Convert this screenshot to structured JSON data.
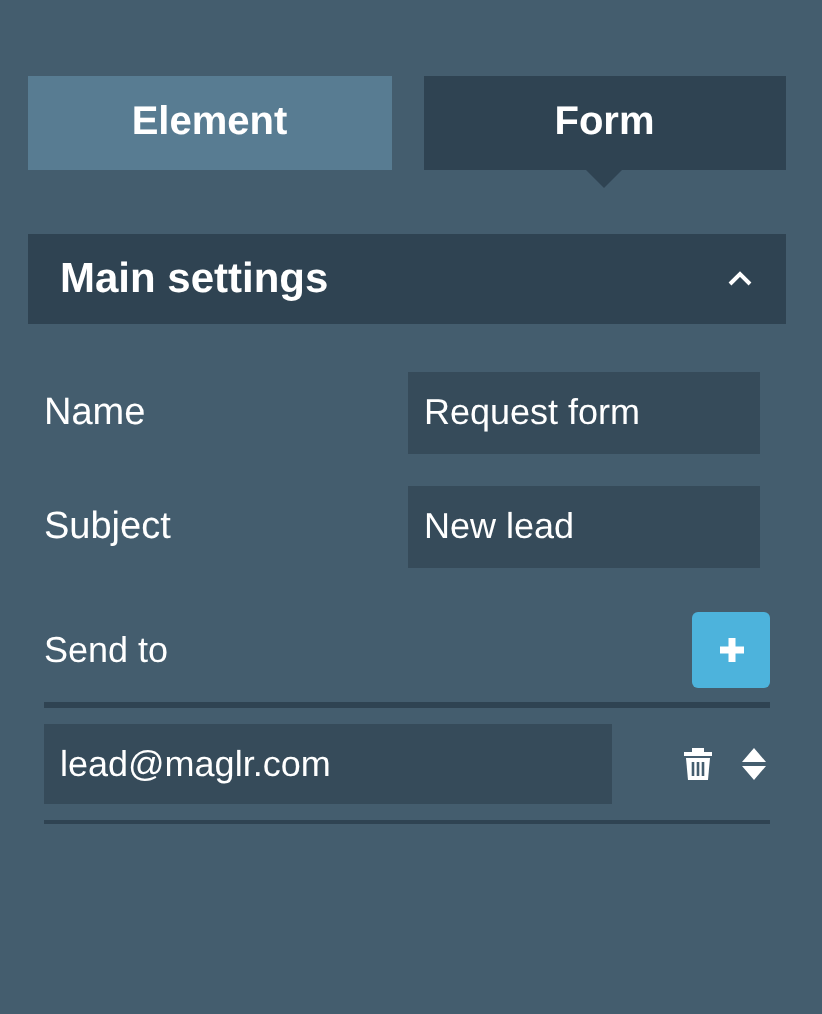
{
  "tabs": [
    {
      "label": "Element",
      "selected": false
    },
    {
      "label": "Form",
      "selected": true
    }
  ],
  "section": {
    "title": "Main settings",
    "expanded": true
  },
  "fields": [
    {
      "label": "Name",
      "value": "Request form"
    },
    {
      "label": "Subject",
      "value": "New lead"
    }
  ],
  "send_to": {
    "label": "Send to",
    "recipients": [
      {
        "value": "lead@maglr.com"
      }
    ]
  }
}
